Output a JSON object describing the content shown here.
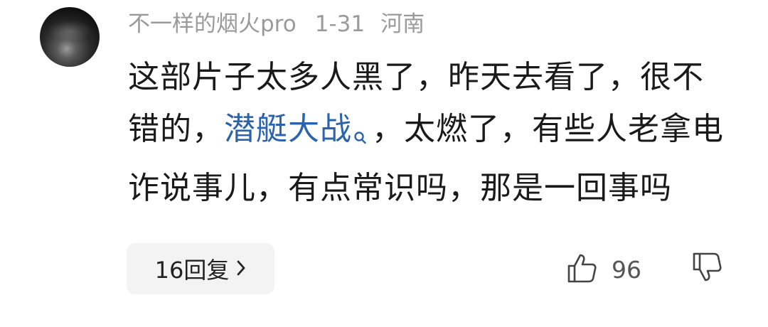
{
  "comment": {
    "username": "不一样的烟火pro",
    "date": "1-31",
    "location": "河南",
    "text_before_keyword": "这部片子太多人黑了，昨天去看了，很不错的，",
    "keyword": "潜艇大战",
    "text_after_keyword": "，太燃了，有些人老拿电诈说事儿，有点常识吗，那是一回事吗",
    "keyword_color": "#2b63ad",
    "reply_label": "16回复",
    "like_count": "96"
  },
  "icons": {
    "keyword_search": "search-icon",
    "reply_arrow": "chevron-right-icon",
    "like": "thumbs-up-icon",
    "dislike": "thumbs-down-icon"
  }
}
